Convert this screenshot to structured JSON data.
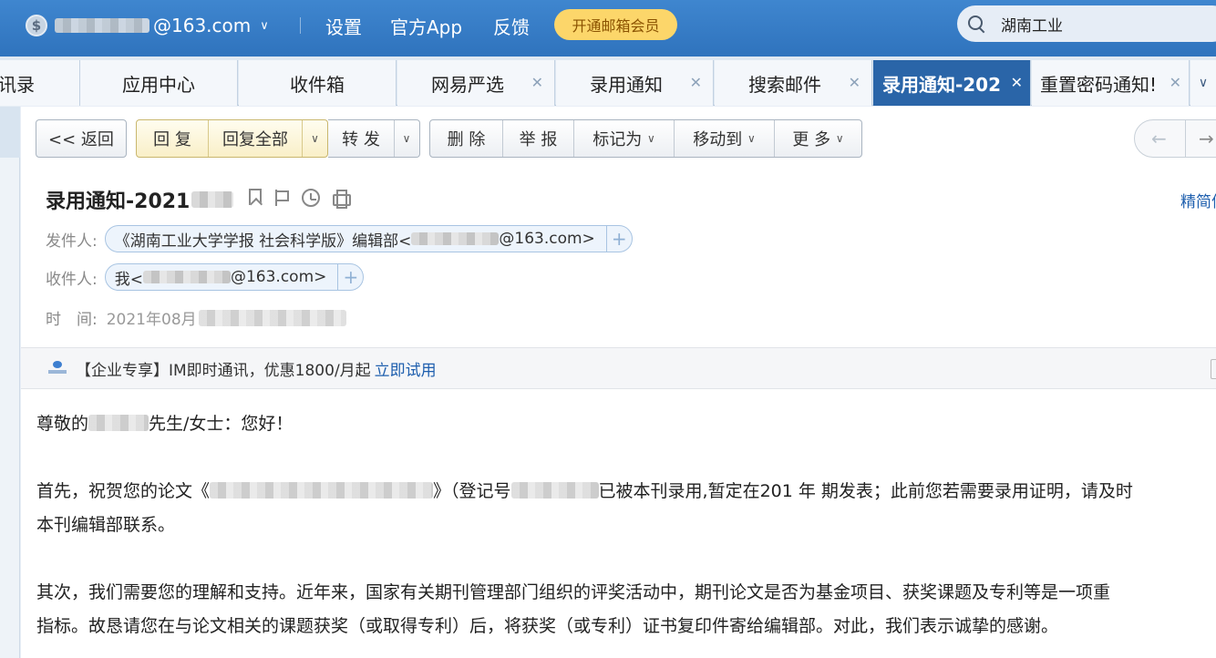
{
  "topbar": {
    "account_domain": "@163.com",
    "nav": [
      "设置",
      "官方App",
      "反馈"
    ],
    "vip_label": "开通邮箱会员",
    "search_value": "湖南工业"
  },
  "tabs": [
    {
      "label": "讯录",
      "closable": false
    },
    {
      "label": "应用中心",
      "closable": false
    },
    {
      "label": "收件箱",
      "closable": false
    },
    {
      "label": "网易严选",
      "closable": true
    },
    {
      "label": "录用通知",
      "closable": true
    },
    {
      "label": "搜索邮件",
      "closable": true
    },
    {
      "label": "录用通知-202",
      "closable": true,
      "active": true
    },
    {
      "label": "重置密码通知!",
      "closable": true
    }
  ],
  "toolbar": {
    "back": "<< 返回",
    "reply": "回 复",
    "reply_all": "回复全部",
    "forward": "转 发",
    "delete": "删 除",
    "report": "举 报",
    "mark_as": "标记为",
    "move_to": "移动到",
    "more": "更 多"
  },
  "mail": {
    "subject": "录用通知-2021",
    "concise_link": "精简信",
    "from_label": "发件人:",
    "from_name": "《湖南工业大学学报 社会科学版》编辑部<",
    "from_domain": "@163.com>",
    "to_label": "收件人:",
    "to_name": "我<",
    "to_domain": "@163.com>",
    "time_label": "时　间:",
    "time_value": "2021年08月"
  },
  "ad": {
    "text": "【企业专享】IM即时通讯，优惠1800/月起",
    "link": "立即试用"
  },
  "body": {
    "greeting_pre": "尊敬的",
    "greeting_post": "先生/女士：您好！",
    "p1_a": "首先，祝贺您的论文《",
    "p1_b": "》（登记号",
    "p1_c": "已被本刊录用,暂定在201 年 期发表；此前您若需要录用证明，请及时",
    "p1_line2": "本刊编辑部联系。",
    "p2_line1": "其次，我们需要您的理解和支持。近年来，国家有关期刊管理部门组织的评奖活动中，期刊论文是否为基金项目、获奖课题及专利等是一项重",
    "p2_line2": "指标。故恳请您在与论文相关的课题获奖（或取得专利）后，将获奖（或专利）证书复印件寄给编辑部。对此，我们表示诚挚的感谢。"
  },
  "colors": {
    "topbar": "#3579c4",
    "active_tab": "#2a65a8",
    "vip": "#fcd66a",
    "link": "#1e5fae"
  }
}
